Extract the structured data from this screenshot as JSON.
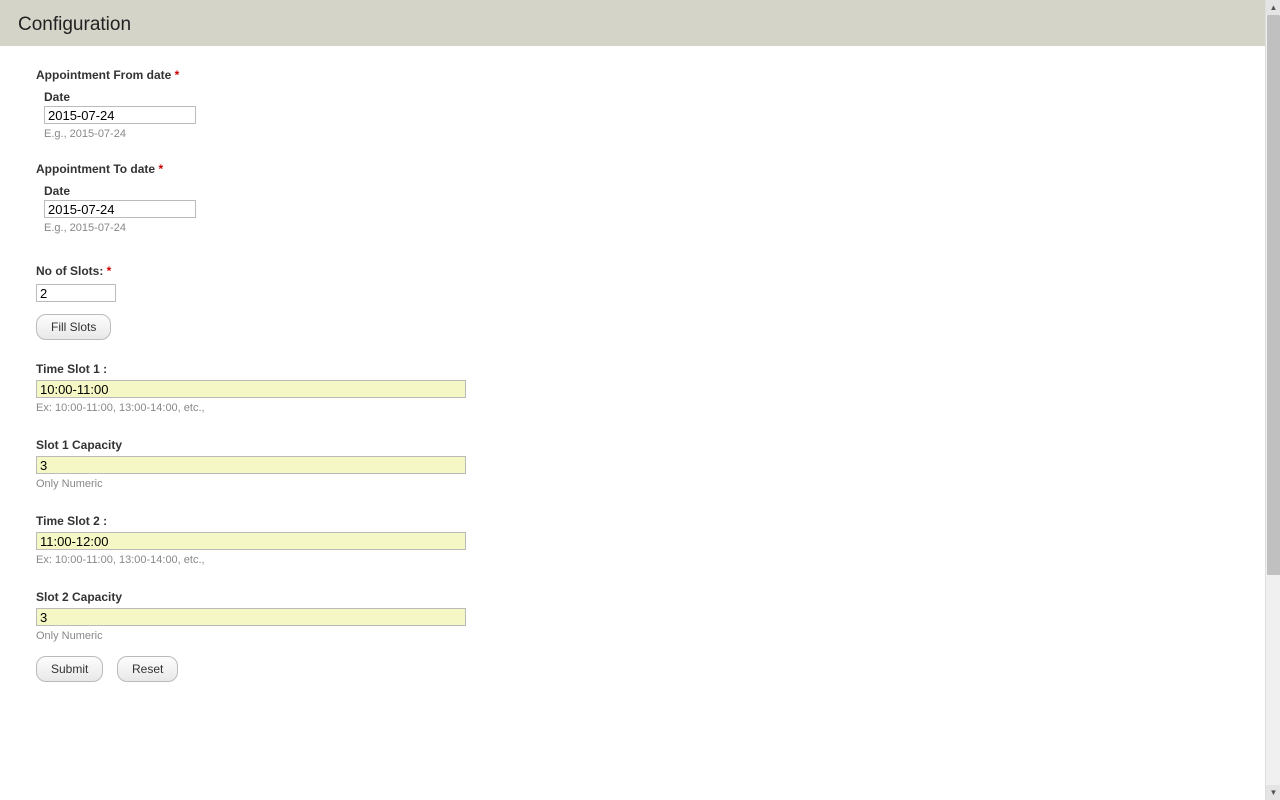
{
  "header": {
    "title": "Configuration"
  },
  "appointment_from": {
    "label": "Appointment From date",
    "required_marker": "*",
    "sub_label": "Date",
    "value": "2015-07-24",
    "hint": "E.g., 2015-07-24"
  },
  "appointment_to": {
    "label": "Appointment To date",
    "required_marker": "*",
    "sub_label": "Date",
    "value": "2015-07-24",
    "hint": "E.g., 2015-07-24"
  },
  "no_of_slots": {
    "label": "No of Slots:",
    "required_marker": "*",
    "value": "2"
  },
  "fill_slots_button": "Fill Slots",
  "slots": [
    {
      "time_label": "Time Slot 1 :",
      "time_value": "10:00-11:00",
      "time_hint": "Ex: 10:00-11:00, 13:00-14:00, etc.,",
      "cap_label": "Slot 1 Capacity",
      "cap_value": "3",
      "cap_hint": "Only Numeric"
    },
    {
      "time_label": "Time Slot 2 :",
      "time_value": "11:00-12:00",
      "time_hint": "Ex: 10:00-11:00, 13:00-14:00, etc.,",
      "cap_label": "Slot 2 Capacity",
      "cap_value": "3",
      "cap_hint": "Only Numeric"
    }
  ],
  "submit_button": "Submit",
  "reset_button": "Reset"
}
